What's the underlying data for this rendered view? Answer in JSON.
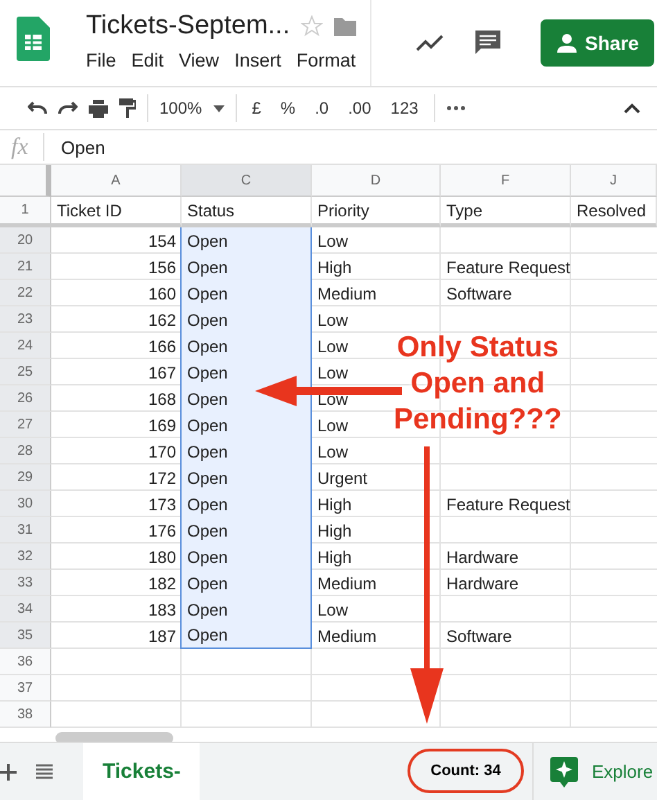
{
  "header": {
    "title": "Tickets-Septem...",
    "starred": false,
    "menu": [
      "File",
      "Edit",
      "View",
      "Insert",
      "Format"
    ],
    "share": "Share"
  },
  "toolbar": {
    "zoom": "100%",
    "items": [
      "£",
      "%",
      ".0",
      ".00",
      "123"
    ]
  },
  "formula_bar": {
    "fx": "fx",
    "value": "Open"
  },
  "sheet": {
    "columns": [
      {
        "letter": "A",
        "selected": false
      },
      {
        "letter": "C",
        "selected": true
      },
      {
        "letter": "D",
        "selected": false
      },
      {
        "letter": "F",
        "selected": false
      },
      {
        "letter": "J",
        "selected": false
      }
    ],
    "header_row": {
      "number": "1",
      "cells": [
        "Ticket ID",
        "Status",
        "Priority",
        "Type",
        "Resolved"
      ]
    },
    "rows": [
      {
        "number": "20",
        "selected": true,
        "id": "154",
        "status": "Open",
        "priority": "Low"
      },
      {
        "number": "21",
        "selected": true,
        "id": "156",
        "status": "Open",
        "priority": "High",
        "type": "Feature Request"
      },
      {
        "number": "22",
        "selected": true,
        "id": "160",
        "status": "Open",
        "priority": "Medium",
        "type": "Software"
      },
      {
        "number": "23",
        "selected": true,
        "id": "162",
        "status": "Open",
        "priority": "Low"
      },
      {
        "number": "24",
        "selected": true,
        "id": "166",
        "status": "Open",
        "priority": "Low"
      },
      {
        "number": "25",
        "selected": true,
        "id": "167",
        "status": "Open",
        "priority": "Low"
      },
      {
        "number": "26",
        "selected": true,
        "id": "168",
        "status": "Open",
        "priority": "Low"
      },
      {
        "number": "27",
        "selected": true,
        "id": "169",
        "status": "Open",
        "priority": "Low"
      },
      {
        "number": "28",
        "selected": true,
        "id": "170",
        "status": "Open",
        "priority": "Low"
      },
      {
        "number": "29",
        "selected": true,
        "id": "172",
        "status": "Open",
        "priority": "Urgent"
      },
      {
        "number": "30",
        "selected": true,
        "id": "173",
        "status": "Open",
        "priority": "High",
        "type": "Feature Request"
      },
      {
        "number": "31",
        "selected": true,
        "id": "176",
        "status": "Open",
        "priority": "High"
      },
      {
        "number": "32",
        "selected": true,
        "id": "180",
        "status": "Open",
        "priority": "High",
        "type": "Hardware"
      },
      {
        "number": "33",
        "selected": true,
        "id": "182",
        "status": "Open",
        "priority": "Medium",
        "type": "Hardware"
      },
      {
        "number": "34",
        "selected": true,
        "id": "183",
        "status": "Open",
        "priority": "Low"
      },
      {
        "number": "35",
        "selected": true,
        "id": "187",
        "status": "Open",
        "priority": "Medium",
        "type": "Software"
      },
      {
        "number": "36",
        "selected": false
      },
      {
        "number": "37",
        "selected": false
      },
      {
        "number": "38",
        "selected": false
      }
    ]
  },
  "annotation": {
    "lines": [
      "Only Status",
      "Open and",
      "Pending???"
    ]
  },
  "bottom": {
    "sheet_tab": "Tickets-",
    "count": "Count: 34",
    "explore": "Explore"
  }
}
